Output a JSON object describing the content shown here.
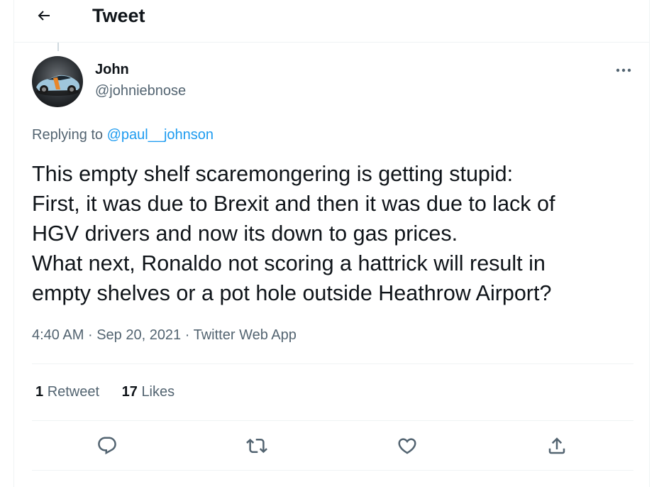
{
  "header": {
    "back_icon": "arrow-left-icon",
    "title": "Tweet"
  },
  "tweet": {
    "author_name": "John",
    "author_handle": "@johniebnose",
    "avatar_icon": "race-car-avatar",
    "more_icon": "more-horizontal-icon",
    "replying_prefix": "Replying to",
    "replying_to": "@paul__johnson",
    "text_lines": [
      "This empty shelf scaremongering is getting stupid:",
      "First, it was due to Brexit and then it was due to lack of",
      "HGV drivers and now its down to gas prices.",
      "What next, Ronaldo not scoring a hattrick will result in",
      "empty shelves or a pot hole outside Heathrow Airport?"
    ],
    "time": "4:40 AM",
    "separator": "·",
    "date": "Sep 20, 2021",
    "source": "Twitter Web App"
  },
  "stats": {
    "retweets_count": "1",
    "retweets_label": "Retweet",
    "likes_count": "17",
    "likes_label": "Likes"
  },
  "actions": [
    {
      "name": "reply",
      "icon": "reply-icon"
    },
    {
      "name": "retweet",
      "icon": "retweet-icon"
    },
    {
      "name": "like",
      "icon": "heart-icon"
    },
    {
      "name": "share",
      "icon": "share-icon"
    }
  ],
  "colors": {
    "accent": "#1d9bf0",
    "secondary_text": "#536471",
    "primary_text": "#0f1419",
    "border": "#eff3f4"
  }
}
